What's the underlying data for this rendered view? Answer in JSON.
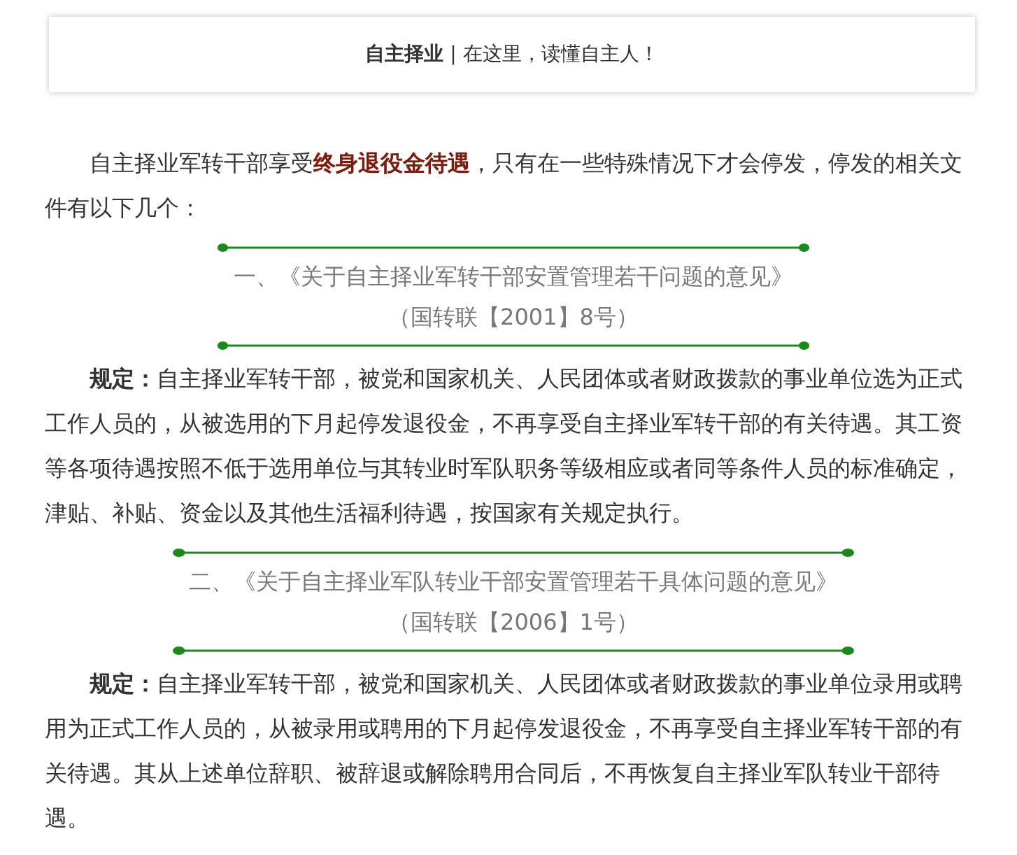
{
  "banner": {
    "text": "**自主择业** | 在这里，读懂自主人！"
  },
  "intro": "自主择业军转干部享受**终身退役金待遇**，只有在一些特殊情况下才会停发，停发的相关文件有以下几个：",
  "documents": [
    {
      "title": "一、《关于自主择业军转干部安置管理若干问题的意见》",
      "code": "（国转联【2001】8号）",
      "rule": "**规定：**自主择业军转干部，被党和国家机关、人民团体或者财政拨款的事业单位选为正式工作人员的，从被选用的下月起停发退役金，不再享受自主择业军转干部的有关待遇。其工资等各项待遇按照不低于选用单位与其转业时军队职务等级相应或者同等条件人员的标准确定，津贴、补贴、资金以及其他生活福利待遇，按国家有关规定执行。"
    },
    {
      "title": "二、《关于自主择业军队转业干部安置管理若干具体问题的意见》",
      "code": "（国转联【2006】1号）",
      "rule": "**规定：**自主择业军转干部，被党和国家机关、人民团体或者财政拨款的事业单位录用或聘用为正式工作人员的，从被录用或聘用的下月起停发退役金，不再享受自主择业军转干部的有关待遇。其从上述单位辞职、被辞退或解除聘用合同后，不再恢复自主择业军队转业干部待遇。"
    }
  ]
}
